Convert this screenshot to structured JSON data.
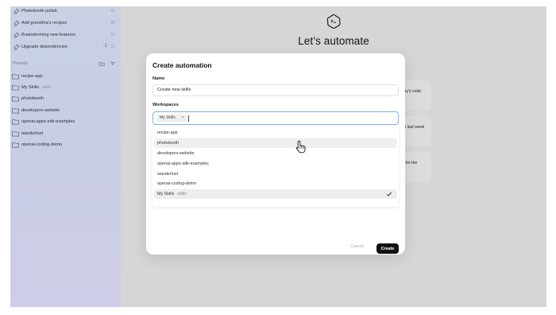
{
  "sidebar": {
    "pinned": [
      {
        "label": "Photobooth polish",
        "time": "8h"
      },
      {
        "label": "Add grandma's recipes",
        "time": "8h"
      },
      {
        "label": "Brainstorming new features",
        "time": "1h"
      },
      {
        "label": "Upgrade dependencies",
        "mark": "-1",
        "time": "1h"
      }
    ],
    "threads_header": "Threads",
    "folders": [
      {
        "label": "recipe-app",
        "sub": ""
      },
      {
        "label": "My Skills",
        "sub": "skills"
      },
      {
        "label": "photobooth",
        "sub": ""
      },
      {
        "label": "developers-website",
        "sub": ""
      },
      {
        "label": "openai-apps-sdk-examples",
        "sub": ""
      },
      {
        "label": "wanderlust",
        "sub": ""
      },
      {
        "label": "openai-coding-demo",
        "sub": ""
      }
    ]
  },
  "main": {
    "title": "Let’s automate",
    "cards": [
      {
        "text": "sts every evening for today's code\ns"
      },
      {
        "text": "arize my team's PRs from last week\nMonday morning"
      },
      {
        "text": "elease notes every week for the\nbuild"
      }
    ]
  },
  "modal": {
    "title": "Create automation",
    "name_label": "Name",
    "name_value": "Create new skills",
    "workspaces_label": "Workspaces",
    "chip_label": "My Skills",
    "chip_remove": "×",
    "options": [
      {
        "label": "recipe-app",
        "sub": ""
      },
      {
        "label": "photobooth",
        "sub": ""
      },
      {
        "label": "developers-website",
        "sub": ""
      },
      {
        "label": "openai-apps-sdk-examples",
        "sub": ""
      },
      {
        "label": "wanderlust",
        "sub": ""
      },
      {
        "label": "openai-coding-demo",
        "sub": ""
      },
      {
        "label": "My Skills",
        "sub": "skills"
      }
    ],
    "hovered_option": "photobooth",
    "selected_option": "My Skills",
    "cancel_label": "Cancel",
    "create_label": "Create"
  },
  "icons": {
    "pin": "pin-icon",
    "folder": "folder-icon",
    "new_folder": "new-folder-icon",
    "filter": "filter-icon",
    "logo": "app-logo-icon",
    "check": "check-icon",
    "cursor": "hand-pointer-icon"
  },
  "colors": {
    "accent_focus": "#7fb1e8",
    "create_button": "#111111",
    "sidebar_top": "#c9d1e3",
    "sidebar_bottom": "#cfcde9"
  }
}
